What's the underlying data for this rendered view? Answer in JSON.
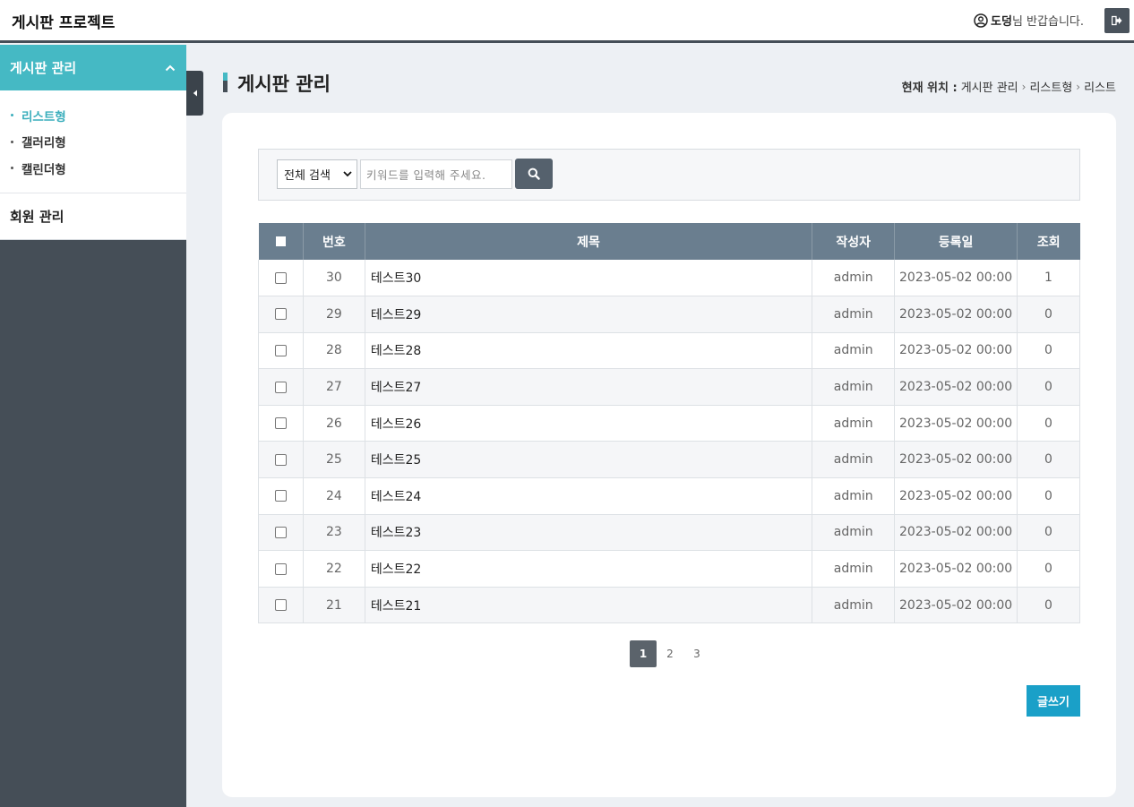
{
  "header": {
    "app_title": "게시판 프로젝트",
    "user_name": "도덩",
    "user_greeting": "님 반갑습니다."
  },
  "sidebar": {
    "groups": [
      {
        "label": "게시판 관리",
        "expanded": true,
        "items": [
          {
            "label": "리스트형",
            "active": true
          },
          {
            "label": "갤러리형",
            "active": false
          },
          {
            "label": "캘린더형",
            "active": false
          }
        ]
      },
      {
        "label": "회원 관리",
        "expanded": false
      }
    ]
  },
  "page": {
    "title": "게시판 관리",
    "breadcrumb_label": "현재 위치 :",
    "breadcrumb": [
      "게시판 관리",
      "리스트형",
      "리스트"
    ]
  },
  "search": {
    "select_value": "전체 검색",
    "placeholder": "키워드를 입력해 주세요."
  },
  "table": {
    "columns": [
      "",
      "번호",
      "제목",
      "작성자",
      "등록일",
      "조회"
    ],
    "rows": [
      {
        "no": "30",
        "title": "테스트30",
        "author": "admin",
        "date": "2023-05-02 00:00",
        "views": "1"
      },
      {
        "no": "29",
        "title": "테스트29",
        "author": "admin",
        "date": "2023-05-02 00:00",
        "views": "0"
      },
      {
        "no": "28",
        "title": "테스트28",
        "author": "admin",
        "date": "2023-05-02 00:00",
        "views": "0"
      },
      {
        "no": "27",
        "title": "테스트27",
        "author": "admin",
        "date": "2023-05-02 00:00",
        "views": "0"
      },
      {
        "no": "26",
        "title": "테스트26",
        "author": "admin",
        "date": "2023-05-02 00:00",
        "views": "0"
      },
      {
        "no": "25",
        "title": "테스트25",
        "author": "admin",
        "date": "2023-05-02 00:00",
        "views": "0"
      },
      {
        "no": "24",
        "title": "테스트24",
        "author": "admin",
        "date": "2023-05-02 00:00",
        "views": "0"
      },
      {
        "no": "23",
        "title": "테스트23",
        "author": "admin",
        "date": "2023-05-02 00:00",
        "views": "0"
      },
      {
        "no": "22",
        "title": "테스트22",
        "author": "admin",
        "date": "2023-05-02 00:00",
        "views": "0"
      },
      {
        "no": "21",
        "title": "테스트21",
        "author": "admin",
        "date": "2023-05-02 00:00",
        "views": "0"
      }
    ]
  },
  "pagination": {
    "pages": [
      "1",
      "2",
      "3"
    ],
    "current": "1"
  },
  "actions": {
    "write_label": "글쓰기"
  },
  "colors": {
    "accent": "#45b9c4",
    "sidebar_bg": "#454e57",
    "table_header": "#6a7e8f",
    "write_button": "#1aa0c8"
  },
  "icons": {
    "user": "user-circle-icon",
    "logout": "logout-icon",
    "chevron_up": "chevron-up-icon",
    "collapse": "caret-left-icon",
    "search": "search-icon",
    "select_arrow": "chevron-down-icon"
  }
}
